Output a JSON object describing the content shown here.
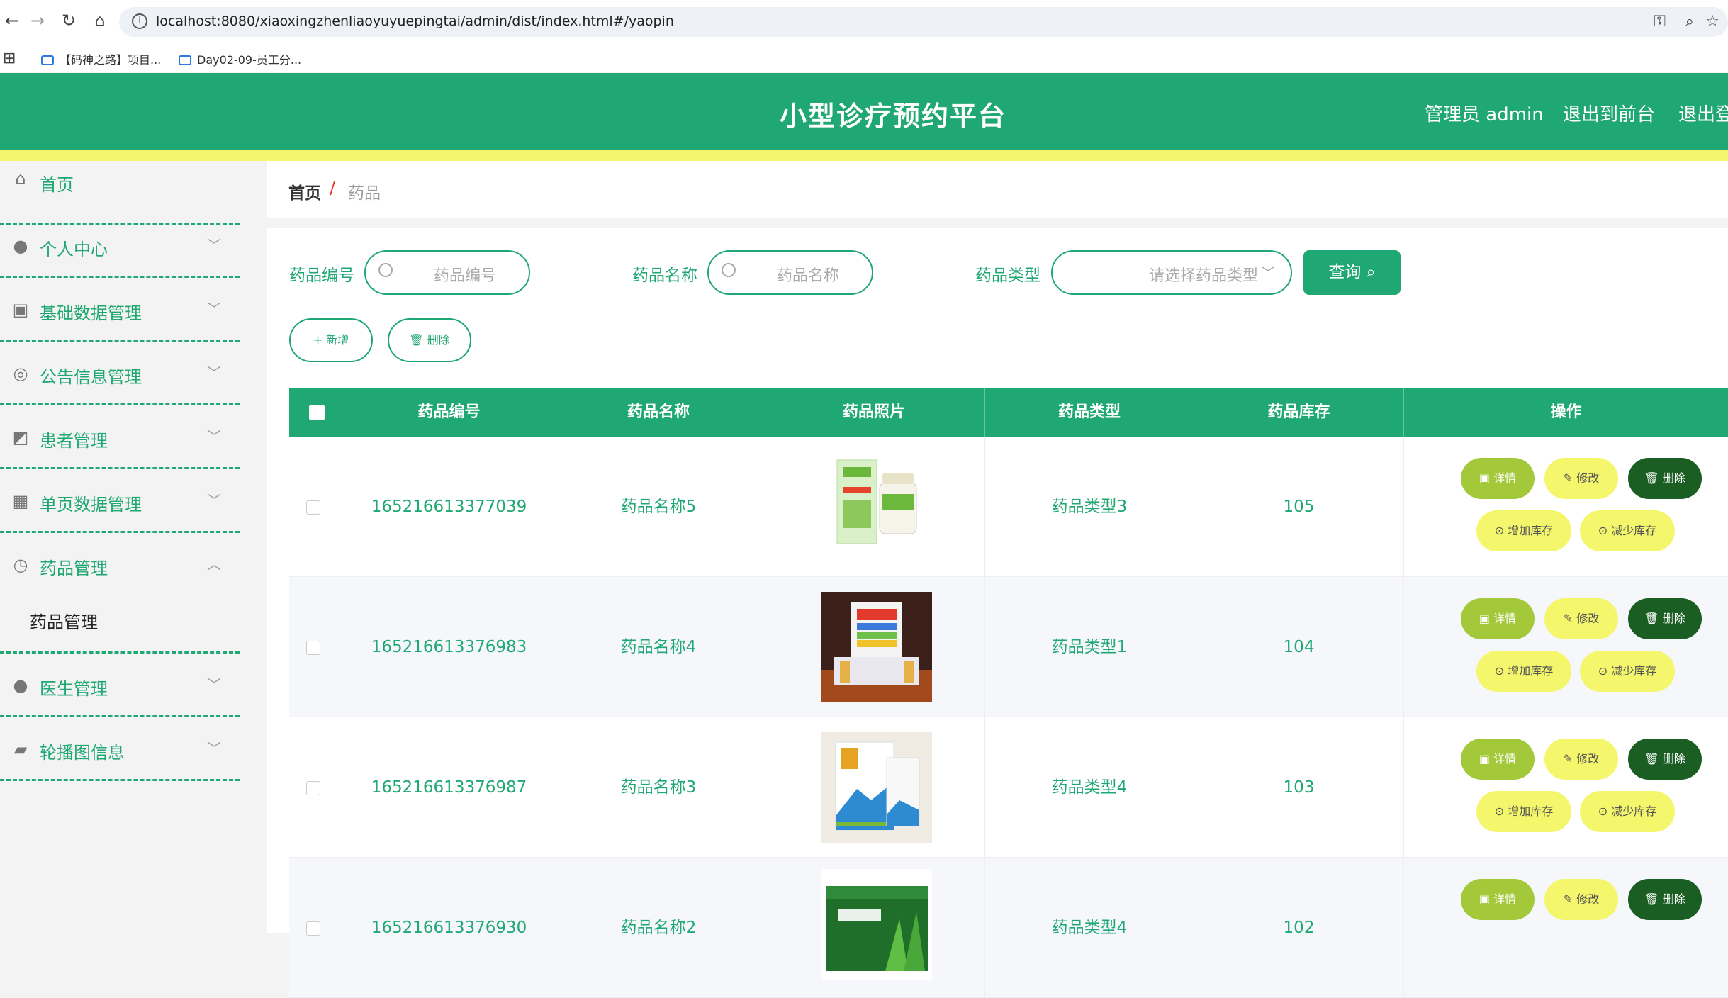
{
  "browser": {
    "url": "localhost:8080/xiaoxingzhenliaoyuyuepingtai/admin/dist/index.html#/yaopin",
    "bookmarks": [
      "【码神之路】项目...",
      "Day02-09-员工分..."
    ]
  },
  "header": {
    "title": "小型诊疗预约平台",
    "user": "管理员 admin",
    "to_front": "退出到前台",
    "logout": "退出登"
  },
  "sidebar": {
    "items": [
      {
        "label": "首页",
        "icon": "home-icon"
      },
      {
        "label": "个人中心",
        "icon": "user-icon"
      },
      {
        "label": "基础数据管理",
        "icon": "clipboard-icon"
      },
      {
        "label": "公告信息管理",
        "icon": "lifebuoy-icon"
      },
      {
        "label": "患者管理",
        "icon": "chart-icon"
      },
      {
        "label": "单页数据管理",
        "icon": "grid-icon"
      },
      {
        "label": "药品管理",
        "icon": "clock-icon"
      },
      {
        "label": "医生管理",
        "icon": "user-icon"
      },
      {
        "label": "轮播图信息",
        "icon": "wallet-icon"
      }
    ],
    "submenu": {
      "label": "药品管理"
    }
  },
  "breadcrumb": {
    "home": "首页",
    "sep": "/",
    "current": "药品"
  },
  "filters": {
    "code_label": "药品编号",
    "code_placeholder": "药品编号",
    "name_label": "药品名称",
    "name_placeholder": "药品名称",
    "type_label": "药品类型",
    "type_placeholder": "请选择药品类型",
    "query_button": "查询"
  },
  "actions": {
    "add": "+ 新增",
    "delete": "删除"
  },
  "table": {
    "columns": [
      "药品编号",
      "药品名称",
      "药品照片",
      "药品类型",
      "药品库存",
      "操作"
    ],
    "rows": [
      {
        "code": "165216613377039",
        "name": "药品名称5",
        "type": "药品类型3",
        "stock": "105"
      },
      {
        "code": "165216613376983",
        "name": "药品名称4",
        "type": "药品类型1",
        "stock": "104"
      },
      {
        "code": "165216613376987",
        "name": "药品名称3",
        "type": "药品类型4",
        "stock": "103"
      },
      {
        "code": "165216613376930",
        "name": "药品名称2",
        "type": "药品类型4",
        "stock": "102"
      }
    ],
    "row_actions": {
      "detail": "详情",
      "edit": "修改",
      "delete": "删除",
      "increase": "增加库存",
      "decrease": "减少库存"
    }
  },
  "colors": {
    "primary": "#1fa774",
    "yellow": "#f4f66c",
    "dark_green": "#1a5e23",
    "olive": "#a3c93a"
  }
}
